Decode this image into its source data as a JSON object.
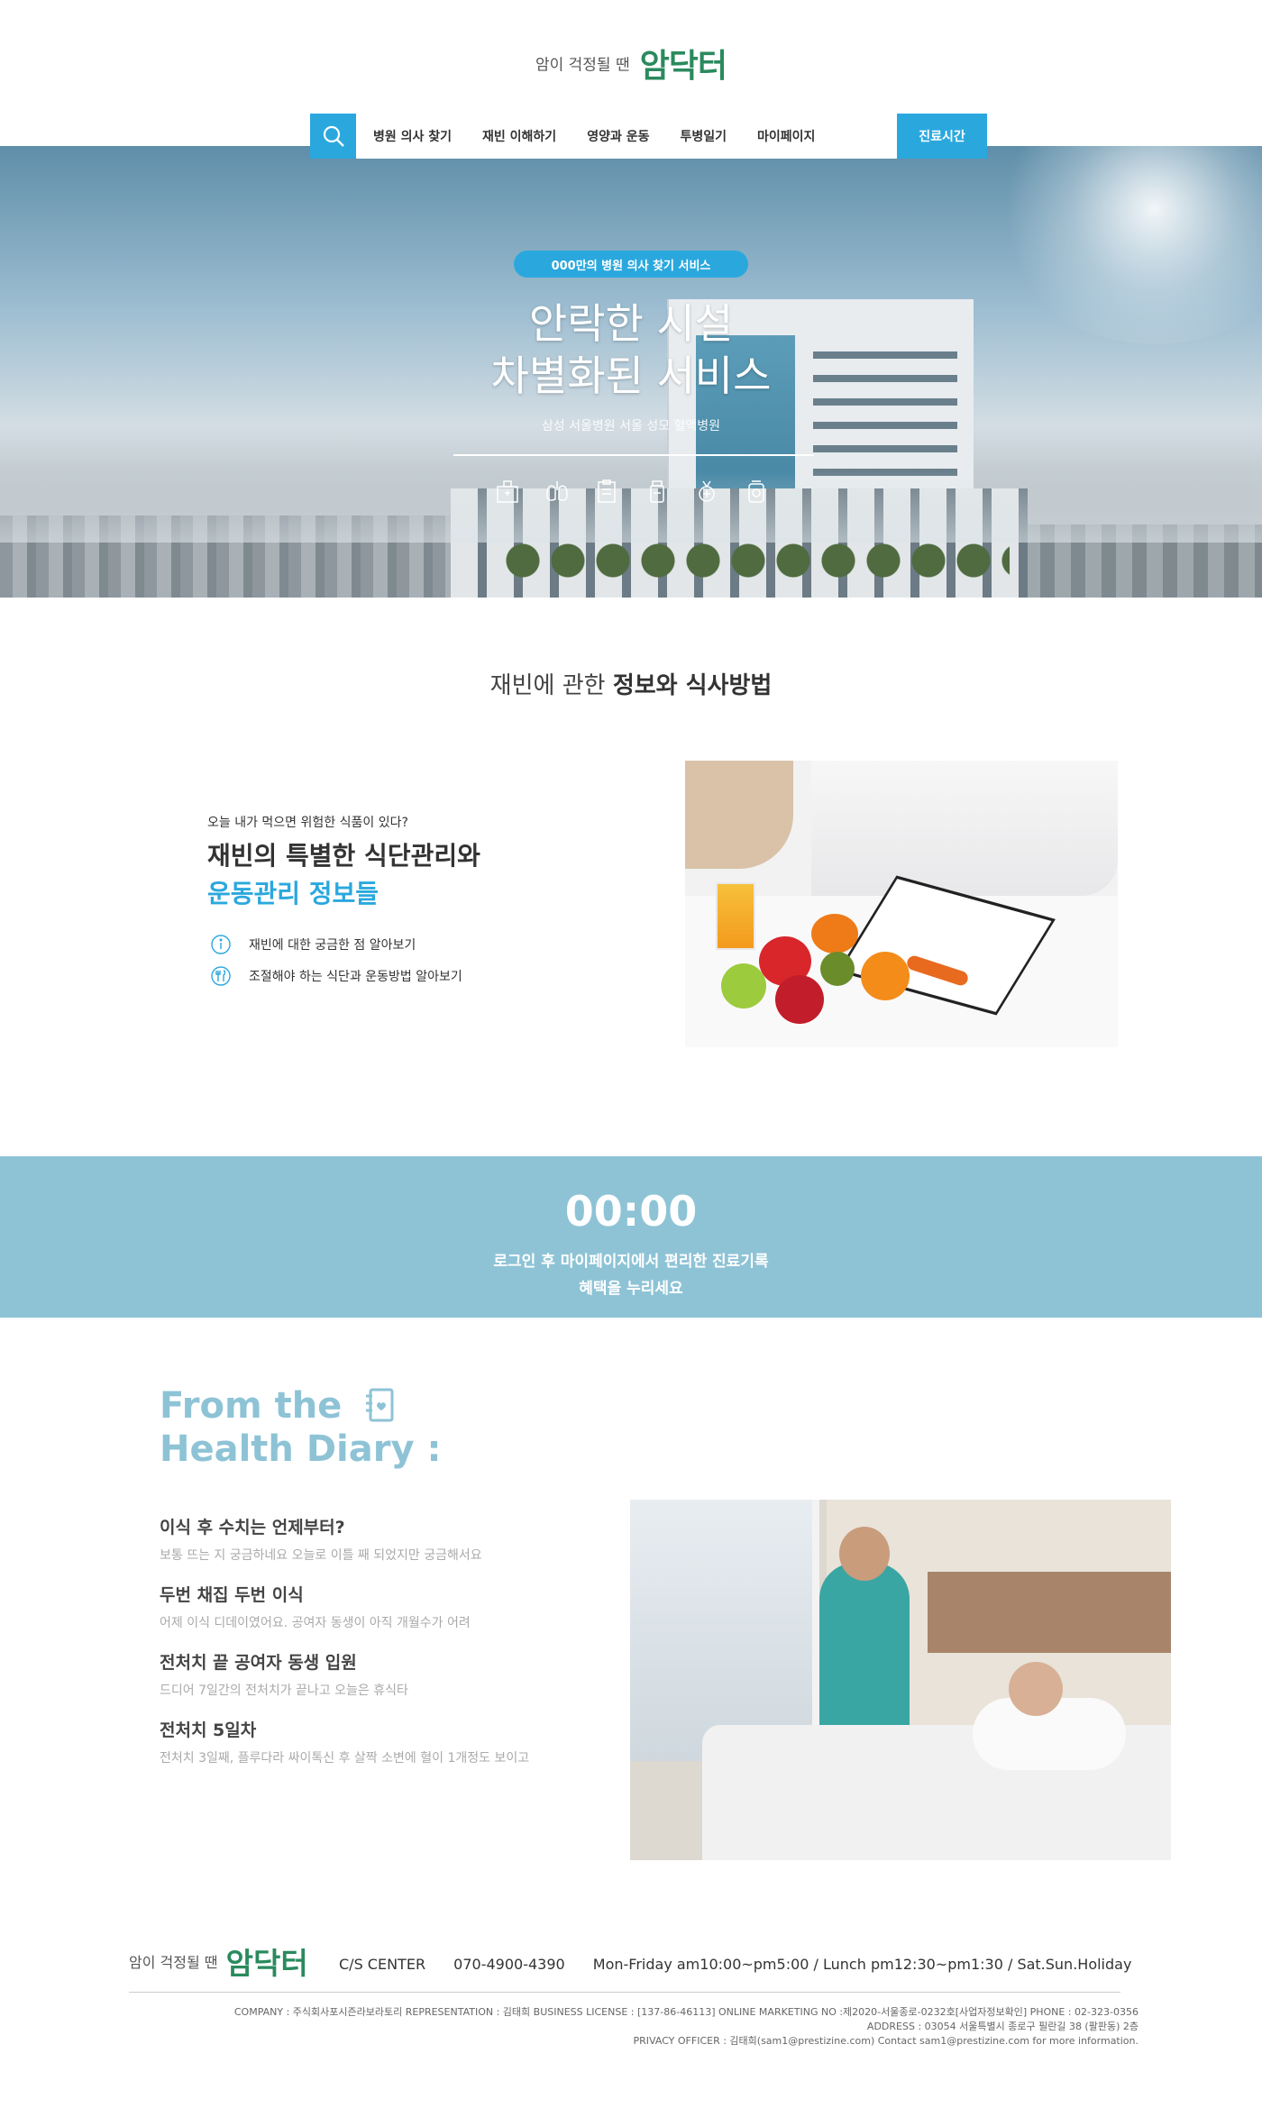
{
  "header": {
    "logo_small": "암이 걱정될 땐",
    "logo_big": "암닥터",
    "nav": [
      "병원 의사 찾기",
      "재빈 이해하기",
      "영양과 운동",
      "투병일기",
      "마이페이지"
    ],
    "cta": "진료시간",
    "search_icon": "search-icon"
  },
  "hero": {
    "badge": "000만의 병원 의사 찾기 서비스",
    "title_line1": "안락한 시설",
    "title_line2": "차별화된 서비스",
    "subtitle": "삼성 서울병원 서울 성모 혈액병원",
    "icons": [
      "hospital-icon",
      "lungs-icon",
      "clipboard-icon",
      "pill-bottle-icon",
      "medal-icon",
      "medicine-icon"
    ]
  },
  "info": {
    "section_title_light": "재빈에 관한",
    "section_title_bold": "정보와 식사방법",
    "kicker": "오늘 내가 먹으면 위험한 식품이 있다?",
    "headline1": "재빈의 특별한 식단관리와",
    "headline2": "운동관리 정보들",
    "rows": [
      {
        "icon": "info-icon",
        "text": "재빈에 대한 궁금한 점 알아보기"
      },
      {
        "icon": "utensils-icon",
        "text": "조절해야 하는 식단과 운동방법 알아보기"
      }
    ]
  },
  "banner": {
    "clock": "00:00",
    "line1": "로그인 후 마이페이지에서 편리한 진료기록",
    "line2": "혜택을 누리세요"
  },
  "diary": {
    "title1": "From the",
    "title2": "Health Diary :",
    "items": [
      {
        "title": "이식 후 수치는 언제부터?",
        "desc": "보통 뜨는 지 궁금하네요 오늘로 이틀 째 되었지만 궁금해서요"
      },
      {
        "title": "두번 채집 두번 이식",
        "desc": "어제 이식 디데이였어요. 공여자 동생이 아직 개월수가 어려"
      },
      {
        "title": "전처치 끝 공여자 동생 입원",
        "desc": "드디어 7일간의 전처치가 끝나고 오늘은 휴식타"
      },
      {
        "title": "전처치 5일차",
        "desc": "전처치 3일째, 플루다라 싸이톡신 후 살짝 소변에 혈이 1개정도 보이고"
      }
    ]
  },
  "footer": {
    "logo_small": "암이 걱정될 땐",
    "logo_big": "암닥터",
    "cs_label": "C/S CENTER",
    "phone": "070-4900-4390",
    "hours": "Mon-Friday am10:00~pm5:00 / Lunch pm12:30~pm1:30 / Sat.Sun.Holiday",
    "company": "COMPANY : 주식회사포시즌라보라토리 REPRESENTATION : 김태희 BUSINESS LICENSE : [137-86-46113] ONLINE MARKETING NO :제2020-서울종로-0232호[사업자정보확인] PHONE : 02-323-0356",
    "address": "ADDRESS : 03054 서울특별시 종로구 필란길 38 (팔판동) 2층",
    "privacy": "PRIVACY OFFICER : 김태희(sam1@prestizine.com) Contact sam1@prestizine.com for more information."
  },
  "colors": {
    "accent": "#2aa8de",
    "brand": "#2a8a5e",
    "banner": "#8ec3d6"
  }
}
